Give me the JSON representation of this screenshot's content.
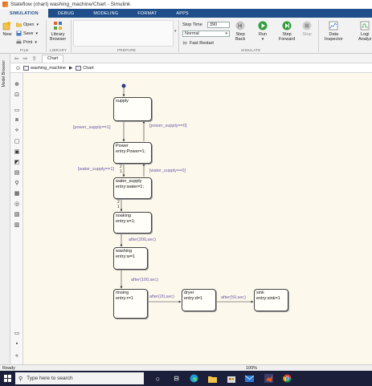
{
  "window": {
    "title": "Stateflow (chart) washing_machine/Chart - Simulink"
  },
  "ribbon": {
    "tabs": [
      "SIMULATION",
      "DEBUG",
      "MODELING",
      "FORMAT",
      "APPS"
    ],
    "active_tab": "SIMULATION"
  },
  "toolstrip": {
    "new_label": "New",
    "open_label": "Open",
    "save_label": "Save",
    "print_label": "Print",
    "library_label": "Library\nBrowser",
    "sections": {
      "file": "FILE",
      "library": "LIBRARY",
      "prepare": "PREPARE",
      "simulate": "SIMULATE"
    },
    "stop_time_label": "Stop Time",
    "stop_time_value": "390",
    "mode_value": "Normal",
    "fast_restart_label": "Fast Restart",
    "step_back_label": "Step\nBack",
    "run_label": "Run",
    "step_forward_label": "Step\nForward",
    "stop_label": "Stop",
    "data_inspector_label": "Data\nInspector",
    "logic_label": "Logi\nAnalyz"
  },
  "navbar": {
    "tab_label": "Chart"
  },
  "breadcrumb": {
    "model": "washing_machine",
    "chart": "Chart"
  },
  "side": {
    "model_browser_label": "Model Browser"
  },
  "diagram": {
    "states": [
      {
        "name": "supply",
        "entry": ""
      },
      {
        "name": "Power",
        "entry": "entry:Power=1;"
      },
      {
        "name": "water_supply",
        "entry": "entry:water=1;"
      },
      {
        "name": "soaking",
        "entry": "entry:s=1;"
      },
      {
        "name": "washing",
        "entry": "entry:w=1"
      },
      {
        "name": "rinsing",
        "entry": "entry:r=1"
      },
      {
        "name": "dryer",
        "entry": "entry:d=1"
      },
      {
        "name": "sink",
        "entry": "entry:sink=1"
      }
    ],
    "transitions": [
      {
        "label": "[power_supply==1]",
        "color": "#6b5aa8"
      },
      {
        "label": "[power_supply==0]",
        "color": "#6b5aa8"
      },
      {
        "label": "[water_supply==1]",
        "color": "#6b5aa8"
      },
      {
        "label": "[water_supply==0]",
        "color": "#6b5aa8"
      },
      {
        "label": "after(200,sec)",
        "color": "#6b5aa8"
      },
      {
        "label": "after(100,sec)",
        "color": "#6b5aa8"
      },
      {
        "label": "after(20,sec)",
        "color": "#6b5aa8"
      },
      {
        "label": "after(50,sec)",
        "color": "#6b5aa8"
      }
    ],
    "execution_order": [
      "2",
      "1",
      "2",
      "1"
    ]
  },
  "status": {
    "left": "Ready",
    "zoom": "100%"
  },
  "taskbar": {
    "search_placeholder": "Type here to search"
  },
  "colors": {
    "ribbon": "#1f4e8a",
    "canvas": "#fdf8ec",
    "taskbar": "#1b1f3a",
    "transition": "#6b5aa8"
  }
}
